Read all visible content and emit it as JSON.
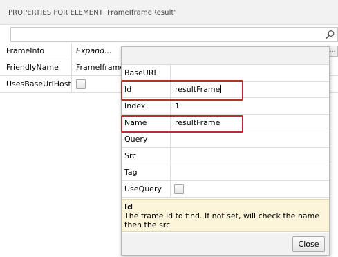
{
  "panel": {
    "title": "PROPERTIES FOR ELEMENT  'FrameIframeResult'"
  },
  "search": {
    "value": "",
    "placeholder": ""
  },
  "properties": [
    {
      "name": "FrameInfo",
      "value": "Expand...",
      "italic": true,
      "has_ellipsis": true
    },
    {
      "name": "FriendlyName",
      "value": "FrameIframeResult"
    },
    {
      "name": "UsesBaseUrlHost",
      "checkbox": true,
      "checked": false
    }
  ],
  "popup": {
    "rows": [
      {
        "name": "BaseURL",
        "value": ""
      },
      {
        "name": "Id",
        "value": "resultFrame",
        "editing": true,
        "highlighted": true
      },
      {
        "name": "Index",
        "value": "1"
      },
      {
        "name": "Name",
        "value": "resultFrame",
        "highlighted": true
      },
      {
        "name": "Query",
        "value": ""
      },
      {
        "name": "Src",
        "value": ""
      },
      {
        "name": "Tag",
        "value": ""
      },
      {
        "name": "UseQuery",
        "checkbox": true,
        "checked": false
      }
    ],
    "description": {
      "title": "Id",
      "text": "The frame id to find. If not set, will check the name then the src"
    },
    "close_label": "Close"
  },
  "colors": {
    "highlight_border": "#b3302c",
    "description_bg": "#fdf5da",
    "header_bg": "#f2f2f2"
  },
  "icons": {
    "search": "magnifier-icon",
    "ellipsis": "ellipsis-button"
  }
}
